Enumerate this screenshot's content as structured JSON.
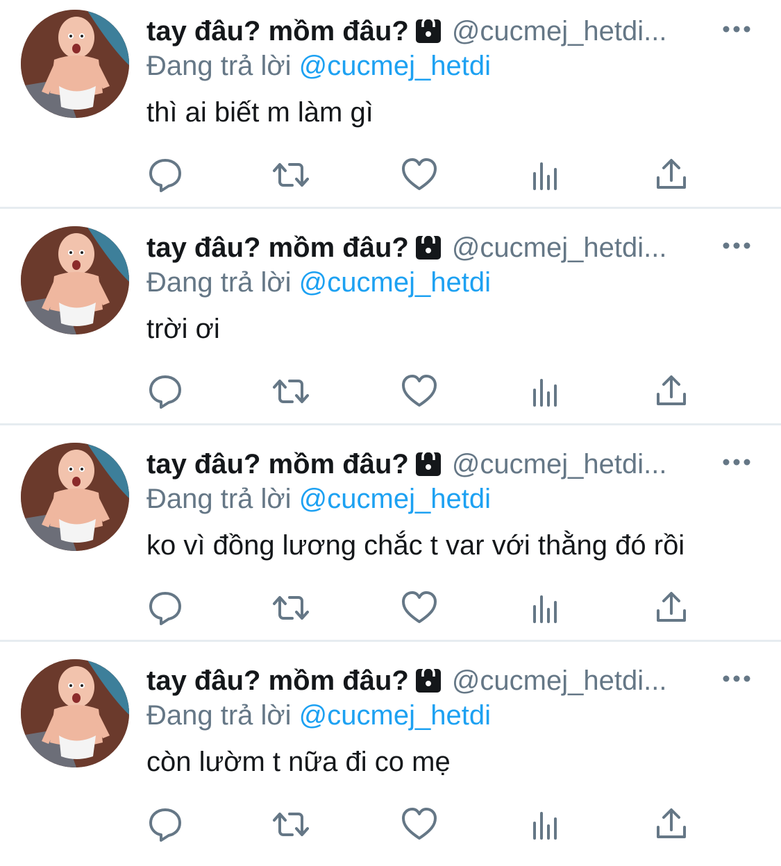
{
  "tweets": [
    {
      "display_name": "tay đâu? mồm đâu?",
      "handle": "@cucmej_hetdi...",
      "reply_prefix": "Đang trả lời",
      "reply_to": "@cucmej_hetdi",
      "text": "thì ai biết m làm gì"
    },
    {
      "display_name": "tay đâu? mồm đâu?",
      "handle": "@cucmej_hetdi...",
      "reply_prefix": "Đang trả lời",
      "reply_to": "@cucmej_hetdi",
      "text": "trời ơi"
    },
    {
      "display_name": "tay đâu? mồm đâu?",
      "handle": "@cucmej_hetdi...",
      "reply_prefix": "Đang trả lời",
      "reply_to": "@cucmej_hetdi",
      "text": "ko vì đồng lương chắc t var với thằng đó rồi"
    },
    {
      "display_name": "tay đâu? mồm đâu?",
      "handle": "@cucmej_hetdi...",
      "reply_prefix": "Đang trả lời",
      "reply_to": "@cucmej_hetdi",
      "text": "còn lườm t nữa đi co mẹ"
    }
  ],
  "icons": {
    "lock": "lock-icon",
    "more": "more-icon",
    "reply": "reply-icon",
    "retweet": "retweet-icon",
    "like": "heart-icon",
    "analytics": "analytics-icon",
    "share": "share-icon"
  },
  "colors": {
    "text": "#14171a",
    "secondary": "#657786",
    "accent": "#1da1f2",
    "divider": "#e6ecf0"
  }
}
